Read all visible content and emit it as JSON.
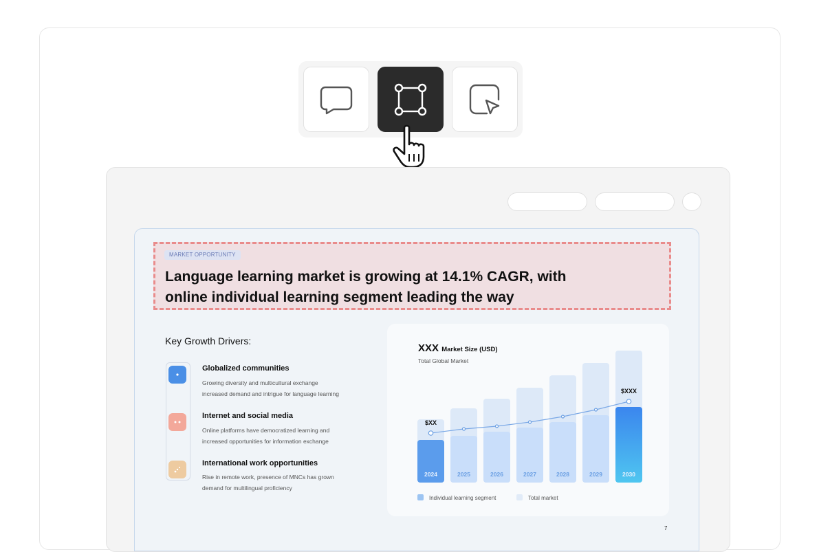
{
  "toolbar": {
    "tools": [
      {
        "name": "comment-tool",
        "icon": "speech-bubble-icon",
        "active": false
      },
      {
        "name": "frame-select-tool",
        "icon": "bounding-box-icon",
        "active": true
      },
      {
        "name": "pointer-note-tool",
        "icon": "note-pointer-icon",
        "active": false
      }
    ]
  },
  "slide": {
    "tag": "MARKET OPPORTUNITY",
    "headline_line1": "Language learning market is growing at 14.1% CAGR, with",
    "headline_line2": "online individual learning segment leading the way",
    "drivers_heading": "Key Growth Drivers:",
    "drivers": [
      {
        "title": "Globalized communities",
        "desc1": "Growing diversity and multicultural exchange",
        "desc2": "increased demand and intrigue for language learning",
        "color": "#4a8fe6"
      },
      {
        "title": "Internet and social media",
        "desc1": "Online platforms have democratized learning and",
        "desc2": "increased opportunities for information exchange",
        "color": "#f3a89a"
      },
      {
        "title": "International work opportunities",
        "desc1": "Rise in remote work, presence of MNCs has grown",
        "desc2": "demand for multilingual proficiency",
        "color": "#eecba0"
      }
    ],
    "page_number": "7"
  },
  "chart_data": {
    "type": "bar",
    "title_big": "XXX",
    "title_small": "Market Size (USD)",
    "subtitle": "Total Global Market",
    "categories": [
      "2024",
      "2025",
      "2026",
      "2027",
      "2028",
      "2029",
      "2030"
    ],
    "series": [
      {
        "name": "Total market",
        "values": [
          46,
          54,
          61,
          69,
          78,
          87,
          96
        ],
        "color": "#dde9f8"
      },
      {
        "name": "Individual learning segment",
        "values": [
          31,
          34,
          37,
          40,
          44,
          49,
          55
        ],
        "color": "#5b9cec"
      }
    ],
    "line_values": [
      36,
      39,
      41,
      44,
      48,
      53,
      59
    ],
    "annotations": [
      {
        "category": "2024",
        "label": "$XX"
      },
      {
        "category": "2030",
        "label": "$XXX"
      }
    ],
    "ylim": [
      0,
      100
    ],
    "legend": "bottom-left"
  }
}
